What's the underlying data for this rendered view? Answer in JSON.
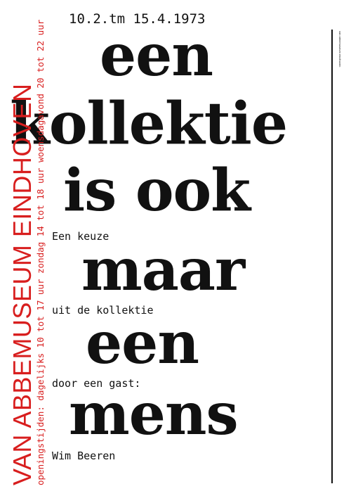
{
  "poster": {
    "dates": "10.2.tm 15.4.1973",
    "headline": [
      "een",
      "kollektie",
      "is ook",
      "maar",
      "een",
      "mens"
    ],
    "subtext": [
      "Een keuze",
      "uit de kollektie",
      "door een gast:",
      "Wim Beeren"
    ],
    "museum_name": "VAN ABBEMUSEUM EINDHOVEN",
    "opening_hours": "openingstijden: dagelijks 10 tot 17 uur zondag 14 tot 18 uur woensdagavond 20 tot 22 uur",
    "credit": "van abbemuseum eindhoven",
    "colors": {
      "accent": "#d81e1e",
      "text": "#111111",
      "background": "#ffffff"
    }
  }
}
